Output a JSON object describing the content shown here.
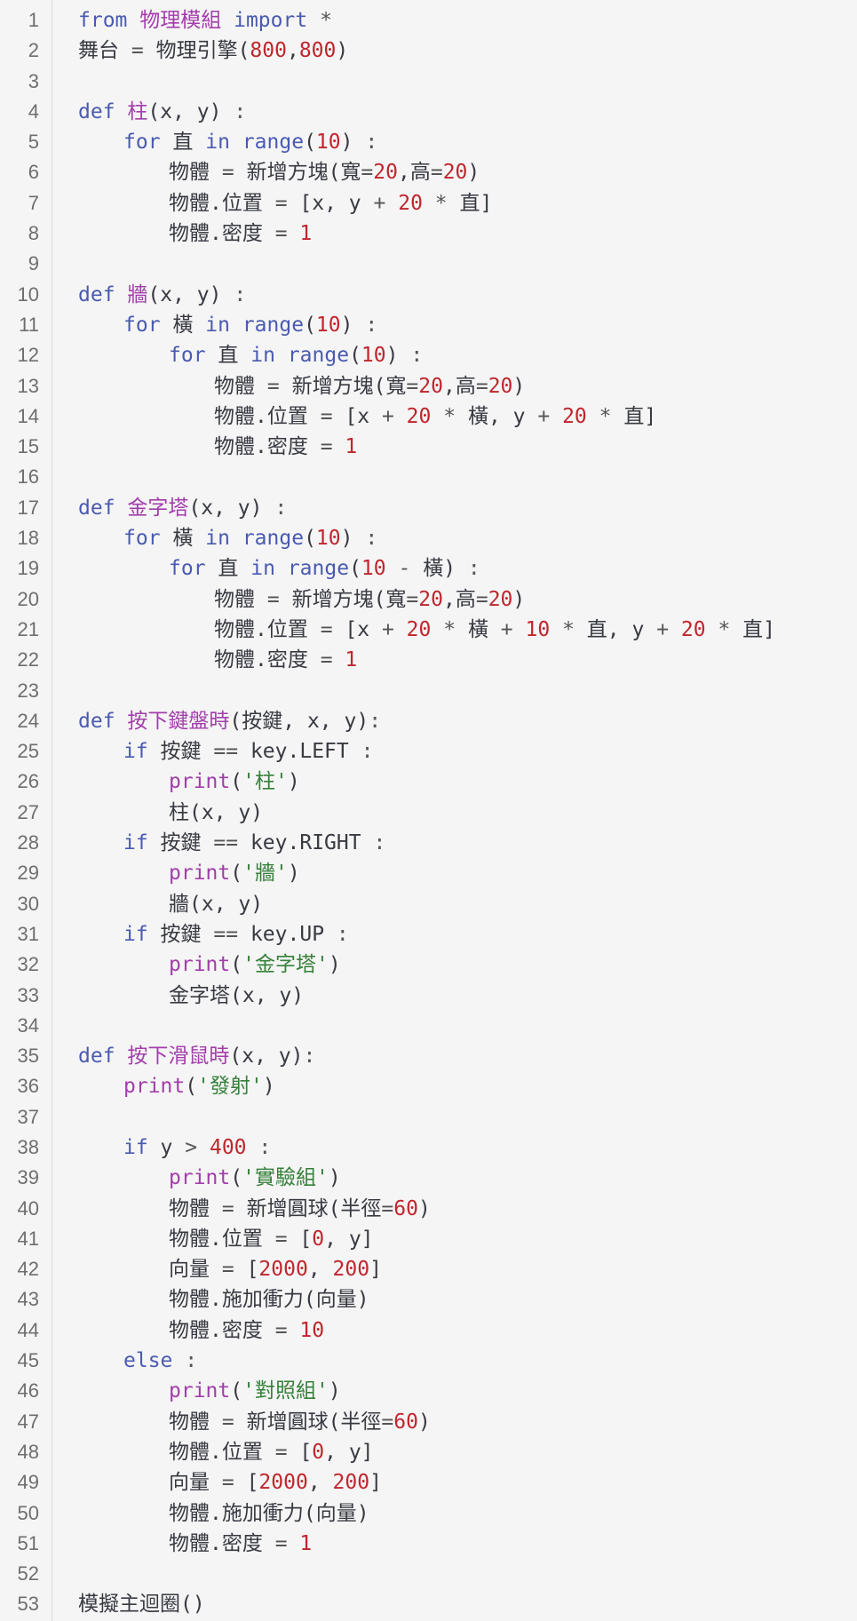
{
  "colors": {
    "background": "#f5f5f5",
    "keyword": "#4a5ab0",
    "function": "#a23eaa",
    "number": "#c0262d",
    "string": "#36803a",
    "operator": "#555555",
    "plain": "#383a42",
    "line_number": "#6e6e6e"
  },
  "lines": [
    {
      "n": "1",
      "indent": 0,
      "tokens": [
        [
          "kw",
          "from"
        ],
        [
          "plain",
          " "
        ],
        [
          "fn",
          "物理模組"
        ],
        [
          "plain",
          " "
        ],
        [
          "kw",
          "import"
        ],
        [
          "plain",
          " "
        ],
        [
          "op",
          "*"
        ]
      ]
    },
    {
      "n": "2",
      "indent": 0,
      "tokens": [
        [
          "plain",
          "舞台 "
        ],
        [
          "op",
          "="
        ],
        [
          "plain",
          " 物理引擎("
        ],
        [
          "num",
          "800"
        ],
        [
          "plain",
          ","
        ],
        [
          "num",
          "800"
        ],
        [
          "plain",
          ")"
        ]
      ]
    },
    {
      "n": "3",
      "indent": 0,
      "tokens": []
    },
    {
      "n": "4",
      "indent": 0,
      "tokens": [
        [
          "kw",
          "def"
        ],
        [
          "plain",
          " "
        ],
        [
          "fn",
          "柱"
        ],
        [
          "plain",
          "(x, y) "
        ],
        [
          "op",
          ":"
        ]
      ]
    },
    {
      "n": "5",
      "indent": 1,
      "tokens": [
        [
          "kw",
          "for"
        ],
        [
          "plain",
          " 直 "
        ],
        [
          "kw",
          "in"
        ],
        [
          "plain",
          " "
        ],
        [
          "kw",
          "range"
        ],
        [
          "plain",
          "("
        ],
        [
          "num",
          "10"
        ],
        [
          "plain",
          ") "
        ],
        [
          "op",
          ":"
        ]
      ]
    },
    {
      "n": "6",
      "indent": 2,
      "tokens": [
        [
          "plain",
          "物體 "
        ],
        [
          "op",
          "="
        ],
        [
          "plain",
          " 新增方塊(寬"
        ],
        [
          "op",
          "="
        ],
        [
          "num",
          "20"
        ],
        [
          "plain",
          ",高"
        ],
        [
          "op",
          "="
        ],
        [
          "num",
          "20"
        ],
        [
          "plain",
          ")"
        ]
      ]
    },
    {
      "n": "7",
      "indent": 2,
      "tokens": [
        [
          "plain",
          "物體.位置 "
        ],
        [
          "op",
          "="
        ],
        [
          "plain",
          " [x, y "
        ],
        [
          "op",
          "+"
        ],
        [
          "plain",
          " "
        ],
        [
          "num",
          "20"
        ],
        [
          "plain",
          " "
        ],
        [
          "op",
          "*"
        ],
        [
          "plain",
          " 直]"
        ]
      ]
    },
    {
      "n": "8",
      "indent": 2,
      "tokens": [
        [
          "plain",
          "物體.密度 "
        ],
        [
          "op",
          "="
        ],
        [
          "plain",
          " "
        ],
        [
          "num",
          "1"
        ]
      ]
    },
    {
      "n": "9",
      "indent": 0,
      "tokens": []
    },
    {
      "n": "10",
      "indent": 0,
      "tokens": [
        [
          "kw",
          "def"
        ],
        [
          "plain",
          " "
        ],
        [
          "fn",
          "牆"
        ],
        [
          "plain",
          "(x, y) "
        ],
        [
          "op",
          ":"
        ]
      ]
    },
    {
      "n": "11",
      "indent": 1,
      "tokens": [
        [
          "kw",
          "for"
        ],
        [
          "plain",
          " 橫 "
        ],
        [
          "kw",
          "in"
        ],
        [
          "plain",
          " "
        ],
        [
          "kw",
          "range"
        ],
        [
          "plain",
          "("
        ],
        [
          "num",
          "10"
        ],
        [
          "plain",
          ") "
        ],
        [
          "op",
          ":"
        ]
      ]
    },
    {
      "n": "12",
      "indent": 2,
      "tokens": [
        [
          "kw",
          "for"
        ],
        [
          "plain",
          " 直 "
        ],
        [
          "kw",
          "in"
        ],
        [
          "plain",
          " "
        ],
        [
          "kw",
          "range"
        ],
        [
          "plain",
          "("
        ],
        [
          "num",
          "10"
        ],
        [
          "plain",
          ") "
        ],
        [
          "op",
          ":"
        ]
      ]
    },
    {
      "n": "13",
      "indent": 3,
      "tokens": [
        [
          "plain",
          "物體 "
        ],
        [
          "op",
          "="
        ],
        [
          "plain",
          " 新增方塊(寬"
        ],
        [
          "op",
          "="
        ],
        [
          "num",
          "20"
        ],
        [
          "plain",
          ",高"
        ],
        [
          "op",
          "="
        ],
        [
          "num",
          "20"
        ],
        [
          "plain",
          ")"
        ]
      ]
    },
    {
      "n": "14",
      "indent": 3,
      "tokens": [
        [
          "plain",
          "物體.位置 "
        ],
        [
          "op",
          "="
        ],
        [
          "plain",
          " [x "
        ],
        [
          "op",
          "+"
        ],
        [
          "plain",
          " "
        ],
        [
          "num",
          "20"
        ],
        [
          "plain",
          " "
        ],
        [
          "op",
          "*"
        ],
        [
          "plain",
          " 橫, y "
        ],
        [
          "op",
          "+"
        ],
        [
          "plain",
          " "
        ],
        [
          "num",
          "20"
        ],
        [
          "plain",
          " "
        ],
        [
          "op",
          "*"
        ],
        [
          "plain",
          " 直]"
        ]
      ]
    },
    {
      "n": "15",
      "indent": 3,
      "tokens": [
        [
          "plain",
          "物體.密度 "
        ],
        [
          "op",
          "="
        ],
        [
          "plain",
          " "
        ],
        [
          "num",
          "1"
        ]
      ]
    },
    {
      "n": "16",
      "indent": 0,
      "tokens": []
    },
    {
      "n": "17",
      "indent": 0,
      "tokens": [
        [
          "kw",
          "def"
        ],
        [
          "plain",
          " "
        ],
        [
          "fn",
          "金字塔"
        ],
        [
          "plain",
          "(x, y) "
        ],
        [
          "op",
          ":"
        ]
      ]
    },
    {
      "n": "18",
      "indent": 1,
      "tokens": [
        [
          "kw",
          "for"
        ],
        [
          "plain",
          " 橫 "
        ],
        [
          "kw",
          "in"
        ],
        [
          "plain",
          " "
        ],
        [
          "kw",
          "range"
        ],
        [
          "plain",
          "("
        ],
        [
          "num",
          "10"
        ],
        [
          "plain",
          ") "
        ],
        [
          "op",
          ":"
        ]
      ]
    },
    {
      "n": "19",
      "indent": 2,
      "tokens": [
        [
          "kw",
          "for"
        ],
        [
          "plain",
          " 直 "
        ],
        [
          "kw",
          "in"
        ],
        [
          "plain",
          " "
        ],
        [
          "kw",
          "range"
        ],
        [
          "plain",
          "("
        ],
        [
          "num",
          "10"
        ],
        [
          "plain",
          " "
        ],
        [
          "op",
          "-"
        ],
        [
          "plain",
          " 橫) "
        ],
        [
          "op",
          ":"
        ]
      ]
    },
    {
      "n": "20",
      "indent": 3,
      "tokens": [
        [
          "plain",
          "物體 "
        ],
        [
          "op",
          "="
        ],
        [
          "plain",
          " 新增方塊(寬"
        ],
        [
          "op",
          "="
        ],
        [
          "num",
          "20"
        ],
        [
          "plain",
          ",高"
        ],
        [
          "op",
          "="
        ],
        [
          "num",
          "20"
        ],
        [
          "plain",
          ")"
        ]
      ]
    },
    {
      "n": "21",
      "indent": 3,
      "tokens": [
        [
          "plain",
          "物體.位置 "
        ],
        [
          "op",
          "="
        ],
        [
          "plain",
          " [x "
        ],
        [
          "op",
          "+"
        ],
        [
          "plain",
          " "
        ],
        [
          "num",
          "20"
        ],
        [
          "plain",
          " "
        ],
        [
          "op",
          "*"
        ],
        [
          "plain",
          " 橫 "
        ],
        [
          "op",
          "+"
        ],
        [
          "plain",
          " "
        ],
        [
          "num",
          "10"
        ],
        [
          "plain",
          " "
        ],
        [
          "op",
          "*"
        ],
        [
          "plain",
          " 直, y "
        ],
        [
          "op",
          "+"
        ],
        [
          "plain",
          " "
        ],
        [
          "num",
          "20"
        ],
        [
          "plain",
          " "
        ],
        [
          "op",
          "*"
        ],
        [
          "plain",
          " 直]"
        ]
      ]
    },
    {
      "n": "22",
      "indent": 3,
      "tokens": [
        [
          "plain",
          "物體.密度 "
        ],
        [
          "op",
          "="
        ],
        [
          "plain",
          " "
        ],
        [
          "num",
          "1"
        ]
      ]
    },
    {
      "n": "23",
      "indent": 0,
      "tokens": []
    },
    {
      "n": "24",
      "indent": 0,
      "tokens": [
        [
          "kw",
          "def"
        ],
        [
          "plain",
          " "
        ],
        [
          "fn",
          "按下鍵盤時"
        ],
        [
          "plain",
          "(按鍵, x, y)"
        ],
        [
          "op",
          ":"
        ]
      ]
    },
    {
      "n": "25",
      "indent": 1,
      "tokens": [
        [
          "kw",
          "if"
        ],
        [
          "plain",
          " 按鍵 "
        ],
        [
          "op",
          "=="
        ],
        [
          "plain",
          " key.LEFT "
        ],
        [
          "op",
          ":"
        ]
      ]
    },
    {
      "n": "26",
      "indent": 2,
      "tokens": [
        [
          "fn",
          "print"
        ],
        [
          "plain",
          "("
        ],
        [
          "str",
          "'柱'"
        ],
        [
          "plain",
          ")"
        ]
      ]
    },
    {
      "n": "27",
      "indent": 2,
      "tokens": [
        [
          "plain",
          "柱(x, y)"
        ]
      ]
    },
    {
      "n": "28",
      "indent": 1,
      "tokens": [
        [
          "kw",
          "if"
        ],
        [
          "plain",
          " 按鍵 "
        ],
        [
          "op",
          "=="
        ],
        [
          "plain",
          " key.RIGHT "
        ],
        [
          "op",
          ":"
        ]
      ]
    },
    {
      "n": "29",
      "indent": 2,
      "tokens": [
        [
          "fn",
          "print"
        ],
        [
          "plain",
          "("
        ],
        [
          "str",
          "'牆'"
        ],
        [
          "plain",
          ")"
        ]
      ]
    },
    {
      "n": "30",
      "indent": 2,
      "tokens": [
        [
          "plain",
          "牆(x, y)"
        ]
      ]
    },
    {
      "n": "31",
      "indent": 1,
      "tokens": [
        [
          "kw",
          "if"
        ],
        [
          "plain",
          " 按鍵 "
        ],
        [
          "op",
          "=="
        ],
        [
          "plain",
          " key.UP "
        ],
        [
          "op",
          ":"
        ]
      ]
    },
    {
      "n": "32",
      "indent": 2,
      "tokens": [
        [
          "fn",
          "print"
        ],
        [
          "plain",
          "("
        ],
        [
          "str",
          "'金字塔'"
        ],
        [
          "plain",
          ")"
        ]
      ]
    },
    {
      "n": "33",
      "indent": 2,
      "tokens": [
        [
          "plain",
          "金字塔(x, y)"
        ]
      ]
    },
    {
      "n": "34",
      "indent": 0,
      "tokens": []
    },
    {
      "n": "35",
      "indent": 0,
      "tokens": [
        [
          "kw",
          "def"
        ],
        [
          "plain",
          " "
        ],
        [
          "fn",
          "按下滑鼠時"
        ],
        [
          "plain",
          "(x, y)"
        ],
        [
          "op",
          ":"
        ]
      ]
    },
    {
      "n": "36",
      "indent": 1,
      "tokens": [
        [
          "fn",
          "print"
        ],
        [
          "plain",
          "("
        ],
        [
          "str",
          "'發射'"
        ],
        [
          "plain",
          ")"
        ]
      ]
    },
    {
      "n": "37",
      "indent": 0,
      "tokens": []
    },
    {
      "n": "38",
      "indent": 1,
      "tokens": [
        [
          "kw",
          "if"
        ],
        [
          "plain",
          " y "
        ],
        [
          "op",
          ">"
        ],
        [
          "plain",
          " "
        ],
        [
          "num",
          "400"
        ],
        [
          "plain",
          " "
        ],
        [
          "op",
          ":"
        ]
      ]
    },
    {
      "n": "39",
      "indent": 2,
      "tokens": [
        [
          "fn",
          "print"
        ],
        [
          "plain",
          "("
        ],
        [
          "str",
          "'實驗組'"
        ],
        [
          "plain",
          ")"
        ]
      ]
    },
    {
      "n": "40",
      "indent": 2,
      "tokens": [
        [
          "plain",
          "物體 "
        ],
        [
          "op",
          "="
        ],
        [
          "plain",
          " 新增圓球(半徑"
        ],
        [
          "op",
          "="
        ],
        [
          "num",
          "60"
        ],
        [
          "plain",
          ")"
        ]
      ]
    },
    {
      "n": "41",
      "indent": 2,
      "tokens": [
        [
          "plain",
          "物體.位置 "
        ],
        [
          "op",
          "="
        ],
        [
          "plain",
          " ["
        ],
        [
          "num",
          "0"
        ],
        [
          "plain",
          ", y]"
        ]
      ]
    },
    {
      "n": "42",
      "indent": 2,
      "tokens": [
        [
          "plain",
          "向量 "
        ],
        [
          "op",
          "="
        ],
        [
          "plain",
          " ["
        ],
        [
          "num",
          "2000"
        ],
        [
          "plain",
          ", "
        ],
        [
          "num",
          "200"
        ],
        [
          "plain",
          "]"
        ]
      ]
    },
    {
      "n": "43",
      "indent": 2,
      "tokens": [
        [
          "plain",
          "物體.施加衝力(向量)"
        ]
      ]
    },
    {
      "n": "44",
      "indent": 2,
      "tokens": [
        [
          "plain",
          "物體.密度 "
        ],
        [
          "op",
          "="
        ],
        [
          "plain",
          " "
        ],
        [
          "num",
          "10"
        ]
      ]
    },
    {
      "n": "45",
      "indent": 1,
      "tokens": [
        [
          "kw",
          "else"
        ],
        [
          "plain",
          " "
        ],
        [
          "op",
          ":"
        ]
      ]
    },
    {
      "n": "46",
      "indent": 2,
      "tokens": [
        [
          "fn",
          "print"
        ],
        [
          "plain",
          "("
        ],
        [
          "str",
          "'對照組'"
        ],
        [
          "plain",
          ")"
        ]
      ]
    },
    {
      "n": "47",
      "indent": 2,
      "tokens": [
        [
          "plain",
          "物體 "
        ],
        [
          "op",
          "="
        ],
        [
          "plain",
          " 新增圓球(半徑"
        ],
        [
          "op",
          "="
        ],
        [
          "num",
          "60"
        ],
        [
          "plain",
          ")"
        ]
      ]
    },
    {
      "n": "48",
      "indent": 2,
      "tokens": [
        [
          "plain",
          "物體.位置 "
        ],
        [
          "op",
          "="
        ],
        [
          "plain",
          " ["
        ],
        [
          "num",
          "0"
        ],
        [
          "plain",
          ", y]"
        ]
      ]
    },
    {
      "n": "49",
      "indent": 2,
      "tokens": [
        [
          "plain",
          "向量 "
        ],
        [
          "op",
          "="
        ],
        [
          "plain",
          " ["
        ],
        [
          "num",
          "2000"
        ],
        [
          "plain",
          ", "
        ],
        [
          "num",
          "200"
        ],
        [
          "plain",
          "]"
        ]
      ]
    },
    {
      "n": "50",
      "indent": 2,
      "tokens": [
        [
          "plain",
          "物體.施加衝力(向量)"
        ]
      ]
    },
    {
      "n": "51",
      "indent": 2,
      "tokens": [
        [
          "plain",
          "物體.密度 "
        ],
        [
          "op",
          "="
        ],
        [
          "plain",
          " "
        ],
        [
          "num",
          "1"
        ]
      ]
    },
    {
      "n": "52",
      "indent": 0,
      "tokens": []
    },
    {
      "n": "53",
      "indent": 0,
      "tokens": [
        [
          "plain",
          "模擬主迴圈()"
        ]
      ]
    }
  ]
}
